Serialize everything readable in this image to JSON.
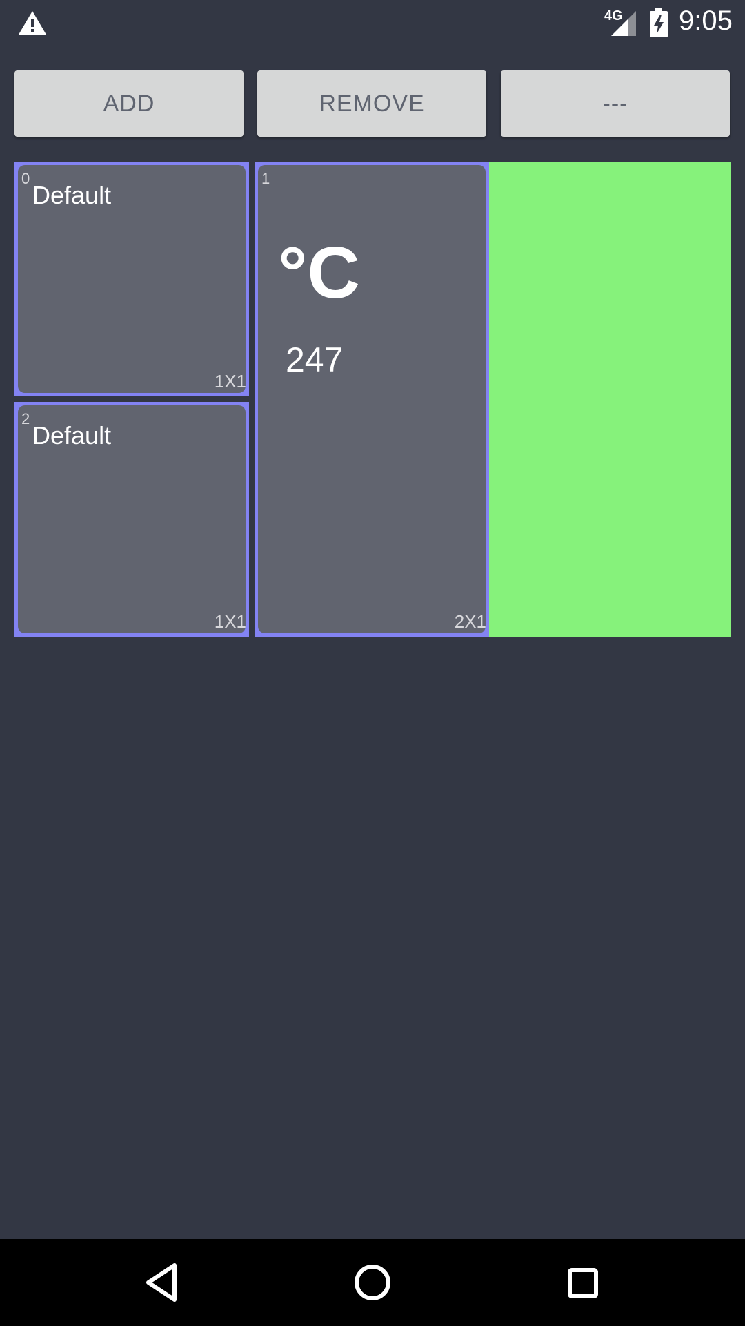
{
  "status_bar": {
    "network": "4G",
    "time": "9:05",
    "icons": [
      "warning-icon",
      "signal-icon",
      "battery-charging-icon"
    ]
  },
  "toolbar": {
    "add_label": "ADD",
    "remove_label": "REMOVE",
    "more_label": "---"
  },
  "tiles": [
    {
      "index": "0",
      "title": "Default",
      "size": "1X1"
    },
    {
      "index": "1",
      "unit": "°C",
      "value": "247",
      "size": "2X1"
    },
    {
      "index": "2",
      "title": "Default",
      "size": "1X1"
    }
  ],
  "colors": {
    "background": "#333744",
    "tile_border": "#8383f3",
    "tile_fill": "#61646f",
    "placeholder_tile": "#86f27b",
    "button": "#d6d7d7"
  },
  "nav_bar": {
    "icons": [
      "back-icon",
      "home-icon",
      "recents-icon"
    ]
  }
}
